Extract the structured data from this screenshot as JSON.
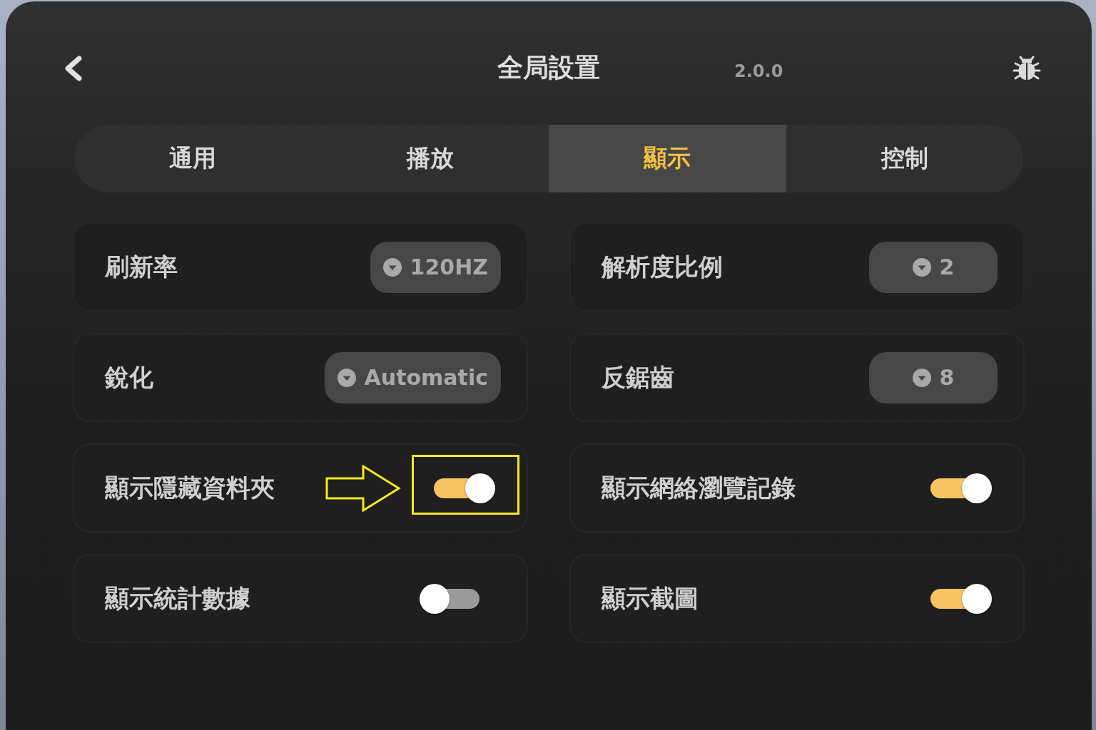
{
  "header": {
    "title": "全局設置",
    "version": "2.0.0"
  },
  "tabs": [
    {
      "label": "通用",
      "selected": false
    },
    {
      "label": "播放",
      "selected": false
    },
    {
      "label": "顯示",
      "selected": true
    },
    {
      "label": "控制",
      "selected": false
    }
  ],
  "settings": [
    {
      "kind": "dropdown",
      "label": "刷新率",
      "value": "120HZ",
      "highlighted": false
    },
    {
      "kind": "dropdown",
      "label": "解析度比例",
      "value": "2",
      "highlighted": false
    },
    {
      "kind": "dropdown",
      "label": "銳化",
      "value": "Automatic",
      "highlighted": false
    },
    {
      "kind": "dropdown",
      "label": "反鋸齒",
      "value": "8",
      "highlighted": false
    },
    {
      "kind": "toggle",
      "label": "顯示隱藏資料夾",
      "on": true,
      "highlighted": true
    },
    {
      "kind": "toggle",
      "label": "顯示網絡瀏覽記錄",
      "on": true,
      "highlighted": false
    },
    {
      "kind": "toggle",
      "label": "顯示統計數據",
      "on": false,
      "highlighted": false
    },
    {
      "kind": "toggle",
      "label": "顯示截圖",
      "on": true,
      "highlighted": false
    }
  ]
}
